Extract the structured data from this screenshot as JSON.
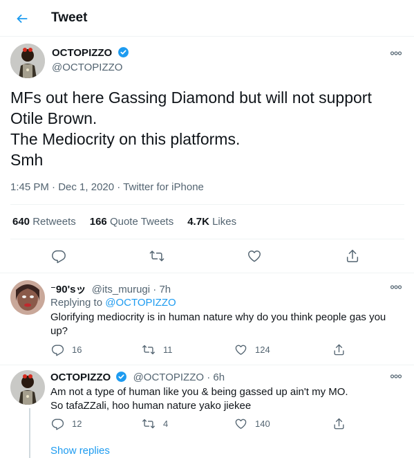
{
  "header": {
    "title": "Tweet"
  },
  "tweet": {
    "author_name": "OCTOPIZZO",
    "author_handle": "@OCTOPIZZO",
    "text_lines": [
      "MFs out here Gassing Diamond but will not support",
      "Otile Brown.",
      "The Mediocrity on this platforms.",
      "Smh"
    ],
    "time": "1:45 PM",
    "date": "Dec 1, 2020",
    "source": "Twitter for iPhone",
    "retweets_count": "640",
    "retweets_label": "Retweets",
    "quotes_count": "166",
    "quotes_label": "Quote Tweets",
    "likes_count": "4.7K",
    "likes_label": "Likes"
  },
  "replies": [
    {
      "name": "⁻90'sッ",
      "handle": "@its_murugi",
      "time": "7h",
      "replying_prefix": "Replying to",
      "replying_to": "@OCTOPIZZO",
      "text_lines": [
        "Glorifying mediocrity is in human nature why do you think people gas you",
        "up?"
      ],
      "reply_count": "16",
      "retweet_count": "11",
      "like_count": "124"
    },
    {
      "name": "OCTOPIZZO",
      "handle": "@OCTOPIZZO",
      "time": "6h",
      "text_lines": [
        "Am not a type of human like you & being gassed up ain't my MO.",
        "So tafaZZali, hoo human nature yako jiekee"
      ],
      "reply_count": "12",
      "retweet_count": "4",
      "like_count": "140"
    }
  ],
  "show_replies": "Show replies",
  "colors": {
    "accent": "#1d9bf0",
    "muted": "#536471",
    "border": "#eff3f4"
  }
}
